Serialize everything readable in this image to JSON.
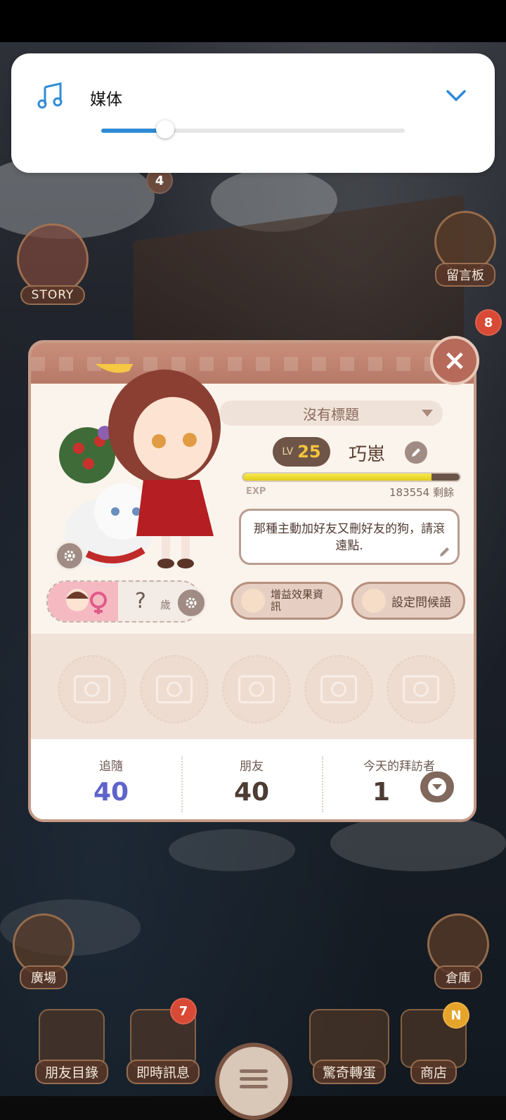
{
  "volume": {
    "label": "媒体",
    "level_percent": 21,
    "icon": "music-note-icon",
    "expand_icon": "chevron-down-icon",
    "accent_color": "#2f8bd5"
  },
  "side_buttons": {
    "story": "STORY",
    "message_board": "留言板",
    "message_board_badge": "8",
    "plaza": "廣場",
    "warehouse": "倉庫",
    "top_badge": "4"
  },
  "profile": {
    "title_select": "沒有標題",
    "level_prefix": "LV",
    "level": "25",
    "name": "巧崽",
    "exp_label": "EXP",
    "exp_fill_percent": 87,
    "exp_remaining": "183554 剩餘",
    "bio": "那種主動加好友又刪好友的狗，請滾遠點.",
    "age": "?",
    "age_unit": "歲",
    "buff_button": "增益效果資訊",
    "greeting_button": "設定問候語",
    "stats": {
      "following_label": "追隨",
      "following_value": "40",
      "friends_label": "朋友",
      "friends_value": "40",
      "visitors_label": "今天的拜訪者",
      "visitors_value": "1"
    },
    "colors": {
      "following": "#5f63c9",
      "friends": "#4e3c34",
      "visitors": "#4e3c34"
    }
  },
  "bottom_bar": {
    "friends_list": "朋友目錄",
    "messages": "即時訊息",
    "messages_badge": "7",
    "gacha": "驚奇轉蛋",
    "shop": "商店",
    "shop_badge": "N"
  }
}
